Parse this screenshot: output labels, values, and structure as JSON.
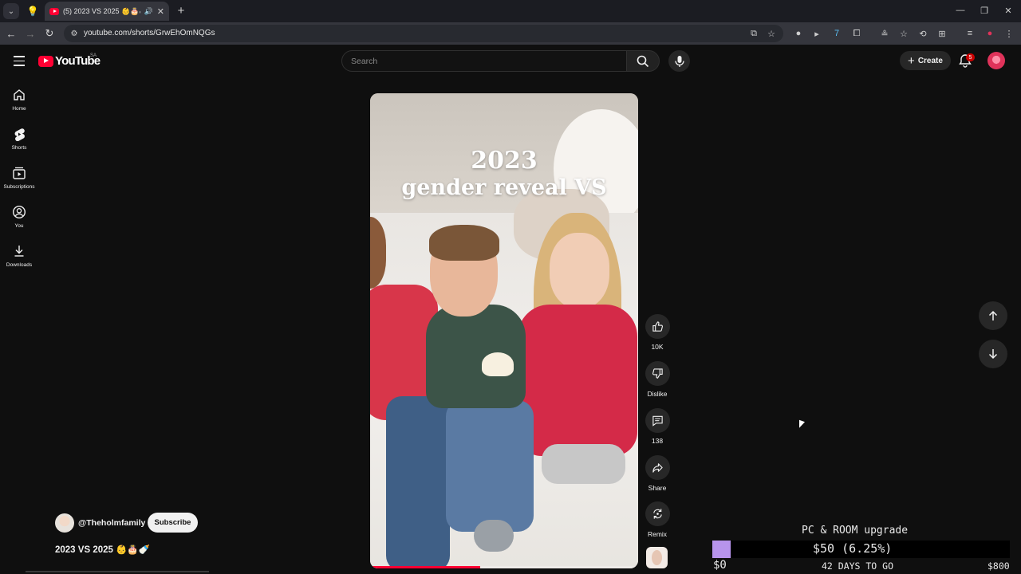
{
  "browser": {
    "tab_title": "(5) 2023 VS 2025 👶🎂🍼 - YouTube",
    "url": "youtube.com/shorts/GrwEhOmNQGs",
    "new_tab": "+",
    "win_minimize": "—",
    "win_restore": "❐",
    "win_close": "✕"
  },
  "header": {
    "logo_text": "YouTube",
    "region": "SA",
    "search_placeholder": "Search",
    "create_label": "Create",
    "notification_count": "5"
  },
  "sidebar": {
    "items": [
      {
        "label": "Home",
        "icon": "home-icon"
      },
      {
        "label": "Shorts",
        "icon": "shorts-icon"
      },
      {
        "label": "Subscriptions",
        "icon": "subscriptions-icon"
      },
      {
        "label": "You",
        "icon": "you-icon"
      },
      {
        "label": "Downloads",
        "icon": "downloads-icon"
      }
    ]
  },
  "video": {
    "caption_line1": "2023",
    "caption_line2": "gender reveal VS",
    "progress": 0.41
  },
  "actions": {
    "likes": "10K",
    "dislike_label": "Dislike",
    "comments": "138",
    "share_label": "Share",
    "remix_label": "Remix"
  },
  "channel": {
    "handle": "@Theholmfamily",
    "subscribe_label": "Subscribe",
    "title": "2023 VS 2025 👶🎂🍼"
  },
  "overlay": {
    "goal_title": "PC & ROOM upgrade",
    "amount": "$50 (6.25%)",
    "min": "$0",
    "days_left": "42 DAYS TO GO",
    "max": "$800",
    "progress": 0.0625,
    "fill_color": "#b794ec"
  },
  "colors": {
    "youtube_red": "#ff0033",
    "background": "#0f0f0f"
  }
}
